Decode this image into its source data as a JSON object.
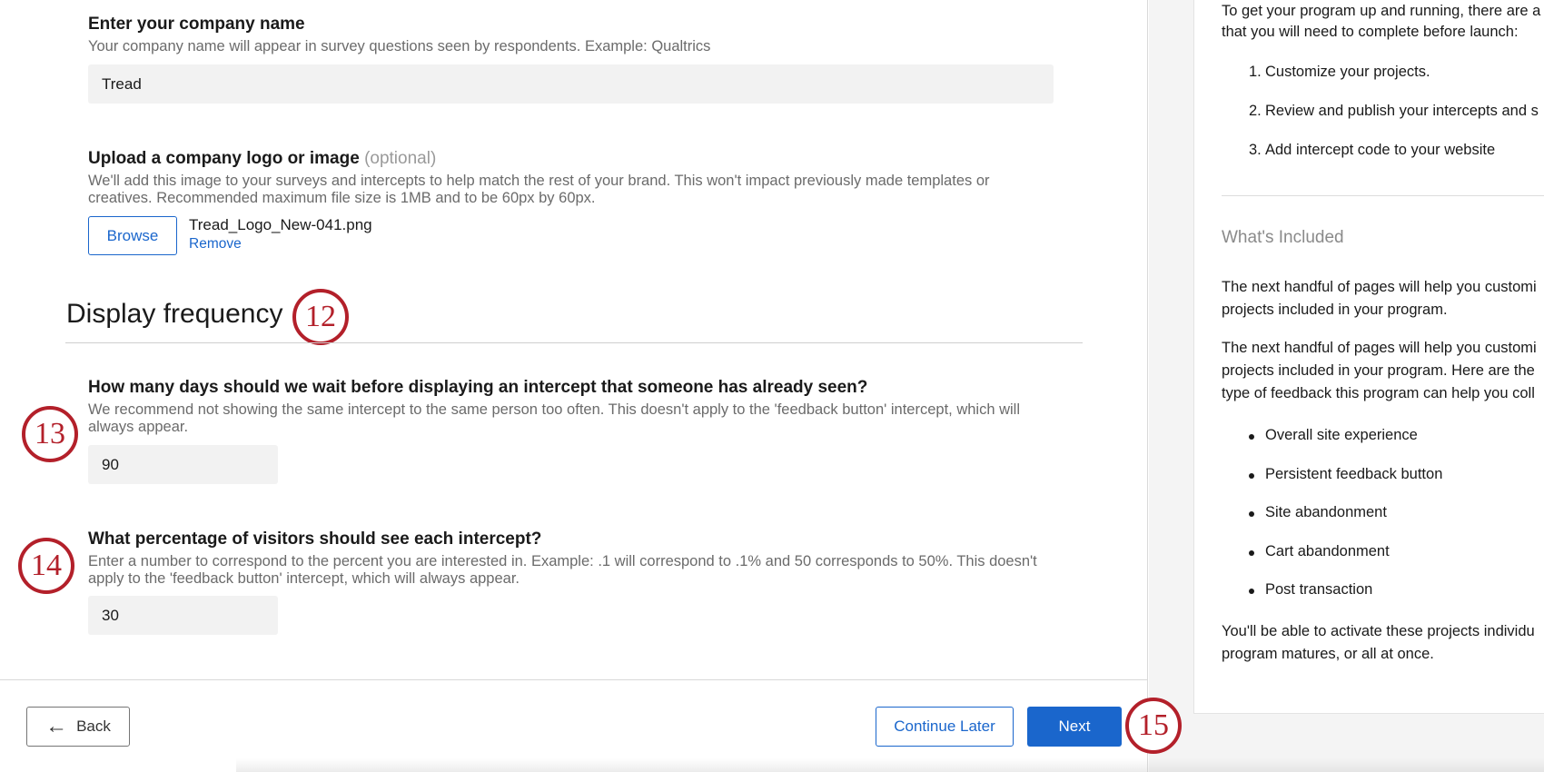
{
  "company": {
    "label": "Enter your company name",
    "help": "Your company name will appear in survey questions seen by respondents. Example: Qualtrics",
    "value": "Tread"
  },
  "logo": {
    "label": "Upload a company logo or image",
    "optional": "(optional)",
    "help_line1": "We'll add this image to your surveys and intercepts to help match the rest of your brand. This won't impact previously made templates or",
    "help_line2": "creatives. Recommended maximum file size is 1MB and to be 60px by 60px.",
    "browse_label": "Browse",
    "filename": "Tread_Logo_New-041.png",
    "remove_label": "Remove"
  },
  "display_frequency": {
    "title": "Display frequency",
    "days": {
      "label": "How many days should we wait before displaying an intercept that someone has already seen?",
      "help_line1": "We recommend not showing the same intercept to the same person too often. This doesn't apply to the 'feedback button' intercept, which will",
      "help_line2": "always appear.",
      "value": "90"
    },
    "percentage": {
      "label": "What percentage of visitors should see each intercept?",
      "help_line1": "Enter a number to correspond to the percent you are interested in. Example: .1 will correspond to .1% and 50 corresponds to 50%. This doesn't",
      "help_line2": "apply to the 'feedback button' intercept, which will always appear.",
      "value": "30"
    }
  },
  "callouts": [
    "12",
    "13",
    "14",
    "15"
  ],
  "footer": {
    "back_label": "Back",
    "continue_label": "Continue Later",
    "next_label": "Next"
  },
  "right_panel": {
    "intro_line1": "To get your program up and running, there are a",
    "intro_line2": "that you will need to complete before launch:",
    "steps": [
      "Customize your projects.",
      "Review and publish your intercepts and s",
      "Add intercept code to your website"
    ],
    "step_numbers": [
      "1.",
      "2.",
      "3."
    ],
    "whats_included": "What's Included",
    "para1_line1": "The next handful of pages will help you customi",
    "para1_line2": "projects included in your program.",
    "para2_line1": "The next handful of pages will help you customi",
    "para2_line2": "projects included in your program. Here are the",
    "para2_line3": "type of feedback this program can help you coll",
    "items": [
      "Overall site experience",
      "Persistent feedback button",
      "Site abandonment",
      "Cart abandonment",
      "Post transaction"
    ],
    "outro_line1": "You'll be able to activate these projects individu",
    "outro_line2": "program matures, or all at once."
  },
  "colors": {
    "accent": "#1a66cc",
    "callout": "#b3202a"
  }
}
